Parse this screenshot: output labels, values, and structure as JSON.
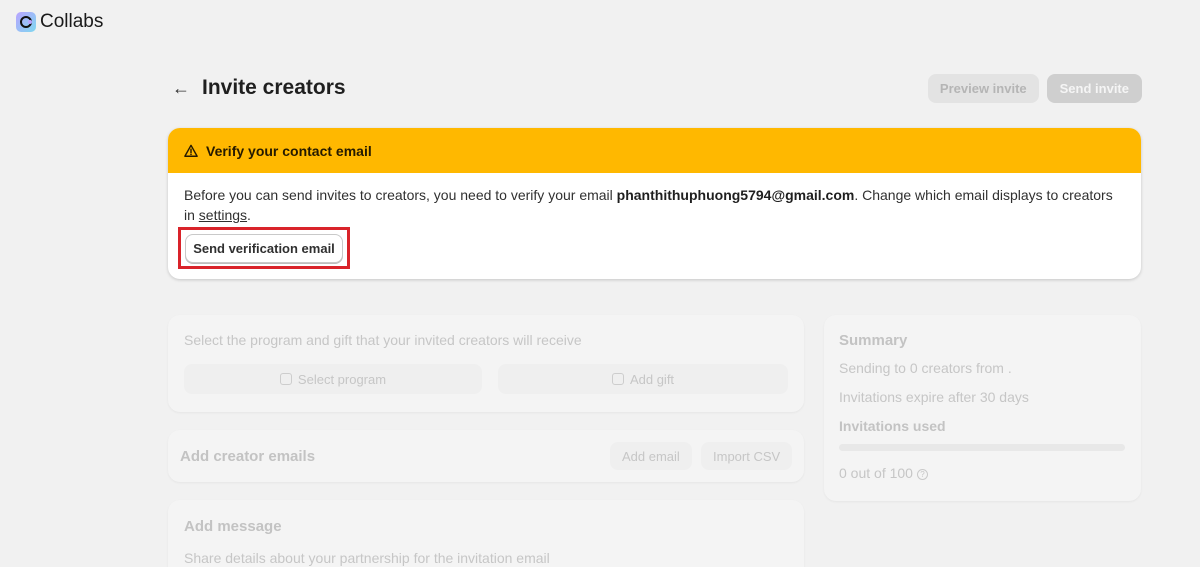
{
  "app": {
    "name": "Collabs",
    "logo_icon": "collabs-logo-icon"
  },
  "header": {
    "title": "Invite creators",
    "back_icon": "arrow-left-icon",
    "preview_label": "Preview invite",
    "send_label": "Send invite"
  },
  "banner": {
    "title": "Verify your contact email",
    "icon": "warning-icon",
    "text_before": "Before you can send invites to creators, you need to verify your email ",
    "email": "phanthithuphuong5794@gmail.com",
    "text_after": ". Change which email displays to creators in ",
    "settings_link": "settings",
    "text_end": ".",
    "button_label": "Send verification email",
    "accent_color": "#ffb800",
    "highlight_color": "#d9232a"
  },
  "program_card": {
    "intro": "Select the program and gift that your invited creators will receive",
    "select_program": "Select program",
    "add_gift": "Add gift"
  },
  "emails_card": {
    "title": "Add creator emails",
    "add_email": "Add email",
    "import_csv": "Import CSV"
  },
  "message_card": {
    "title": "Add message",
    "description": "Share details about your partnership for the invitation email"
  },
  "summary": {
    "title": "Summary",
    "sending": "Sending to 0 creators from .",
    "expire": "Invitations expire after 30 days",
    "used_label": "Invitations used",
    "used_text": "0 out of 100",
    "used_fraction": 0
  }
}
